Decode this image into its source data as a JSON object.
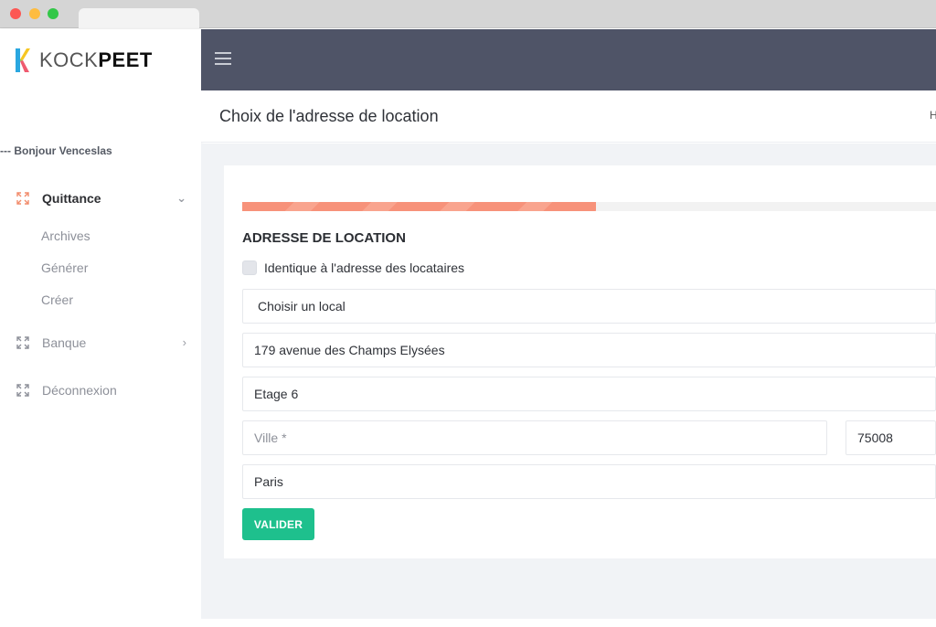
{
  "app": {
    "logo_light": "KOCK",
    "logo_bold": "PEET"
  },
  "sidebar": {
    "greeting": "--- Bonjour Venceslas",
    "items": [
      {
        "label": "Quittance",
        "icon": "expand-icon",
        "active": true,
        "chevron": "⌄"
      },
      {
        "label": "Banque",
        "icon": "expand-icon",
        "active": false,
        "chevron": "›"
      },
      {
        "label": "Déconnexion",
        "icon": "expand-icon",
        "active": false
      }
    ],
    "subitems": [
      {
        "label": "Archives"
      },
      {
        "label": "Générer"
      },
      {
        "label": "Créer"
      }
    ]
  },
  "header": {
    "page_title": "Choix de l'adresse de location",
    "breadcrumb": "H"
  },
  "form": {
    "progress": 0.51,
    "section_title": "ADRESSE DE LOCATION",
    "same_address_label": "Identique à l'adresse des locataires",
    "same_address_checked": false,
    "local_select": "Choisir un local",
    "street": "179 avenue des Champs Elysées",
    "floor": "Etage 6",
    "city_placeholder": "Ville *",
    "postal_code": "75008",
    "city": "Paris",
    "submit_label": "VALIDER"
  },
  "colors": {
    "topbar": "#4f5467",
    "accent_progress": "#f7927a",
    "button": "#1ec08d",
    "active_icon": "#f28b6b"
  }
}
